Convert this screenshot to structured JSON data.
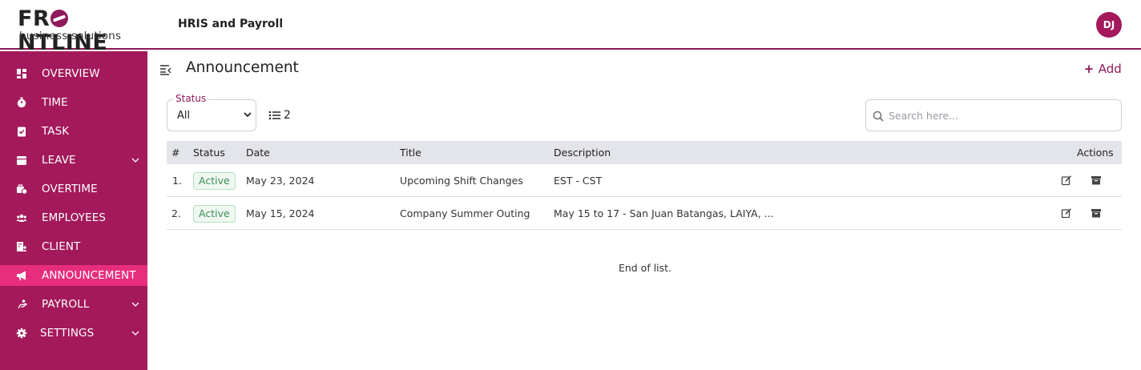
{
  "brand": {
    "name_part1": "FR",
    "name_part2": "NTLINE",
    "subtitle": "business solutions"
  },
  "header": {
    "app_title": "HRIS and Payroll",
    "user_initials": "DJ"
  },
  "colors": {
    "primary": "#a3195b",
    "active_nav": "#e62e7c",
    "accent": "#8e1a5b",
    "active_badge": "#3c8f55"
  },
  "sidebar": {
    "items": [
      {
        "label": "OVERVIEW",
        "icon": "dashboard-icon"
      },
      {
        "label": "TIME",
        "icon": "stopwatch-icon"
      },
      {
        "label": "TASK",
        "icon": "clipboard-check-icon"
      },
      {
        "label": "LEAVE",
        "icon": "calendar-icon",
        "expandable": true
      },
      {
        "label": "OVERTIME",
        "icon": "business-time-icon"
      },
      {
        "label": "EMPLOYEES",
        "icon": "users-icon"
      },
      {
        "label": "CLIENT",
        "icon": "building-user-icon"
      },
      {
        "label": "ANNOUNCEMENT",
        "icon": "megaphone-icon",
        "active": true
      },
      {
        "label": "PAYROLL",
        "icon": "money-hand-icon",
        "expandable": true
      },
      {
        "label": "SETTINGS",
        "icon": "gear-icon",
        "expandable": true
      }
    ]
  },
  "main": {
    "title": "Announcement",
    "add_label": "Add",
    "filter": {
      "legend": "Status",
      "selected": "All",
      "count": "2"
    },
    "search": {
      "placeholder": "Search here..."
    },
    "table": {
      "headers": {
        "index": "#",
        "status": "Status",
        "date": "Date",
        "title": "Title",
        "description": "Description",
        "actions": "Actions"
      },
      "rows": [
        {
          "index": "1.",
          "status": "Active",
          "date": "May 23, 2024",
          "title": "Upcoming Shift Changes",
          "description": "EST - CST"
        },
        {
          "index": "2.",
          "status": "Active",
          "date": "May 15, 2024",
          "title": "Company Summer Outing",
          "description": "May 15 to 17 - San Juan Batangas, LAIYA, ..."
        }
      ]
    },
    "end_of_list": "End of list."
  }
}
